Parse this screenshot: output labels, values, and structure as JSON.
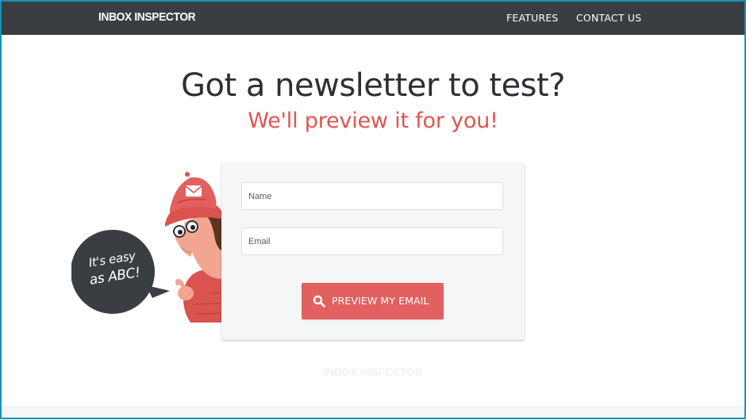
{
  "navbar": {
    "brand": "INBOX INSPECTOR",
    "links": [
      {
        "label": "FEATURES"
      },
      {
        "label": "CONTACT US"
      }
    ],
    "background": "#3a3e42"
  },
  "hero": {
    "title": "Got a newsletter to test?",
    "subtitle": "We'll preview it for you!",
    "title_color": "#2c2f33",
    "subtitle_color": "#e05552"
  },
  "mascot": {
    "speech_bubble": {
      "line1": "It's easy",
      "line2": "as ABC!"
    },
    "icon": "detective-mascot-icon"
  },
  "form": {
    "name_placeholder": "Name",
    "email_placeholder": "Email",
    "submit_label": "PREVIEW MY EMAIL",
    "submit_icon": "search-icon",
    "accent_color": "#e26060"
  },
  "footer": {
    "logo_text": "INBOX INSPECTOR"
  },
  "frame": {
    "border_color": "#1694b4"
  }
}
